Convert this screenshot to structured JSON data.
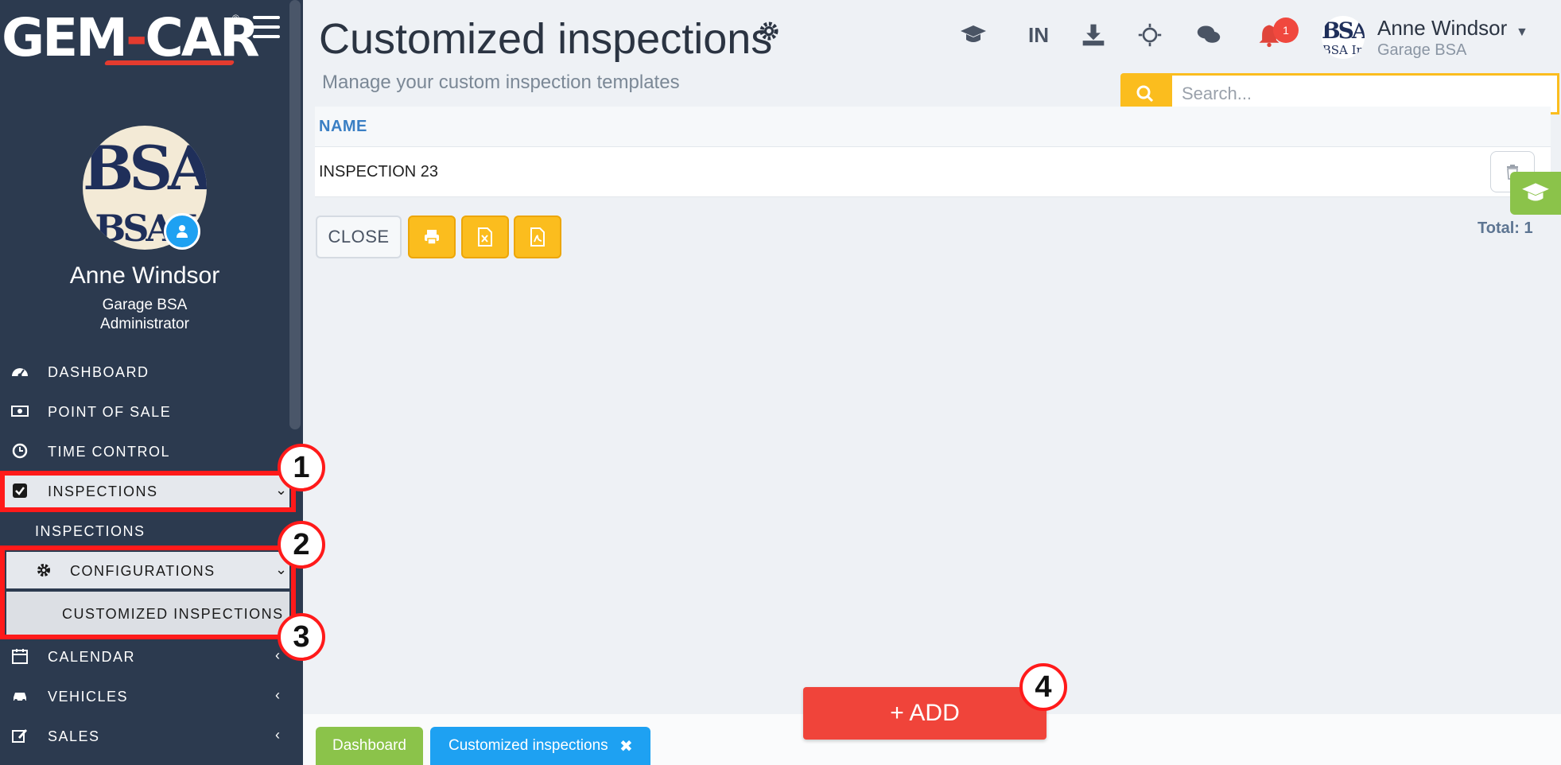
{
  "app": {
    "logo_text": "GEM-CAR",
    "logo_reg": "®"
  },
  "sidebar": {
    "profile": {
      "name": "Anne Windsor",
      "company": "Garage BSA",
      "role": "Administrator",
      "avatar_text": "BSA",
      "avatar_text_2": "BSA I"
    },
    "items": [
      {
        "label": "DASHBOARD",
        "icon": "tachometer-icon"
      },
      {
        "label": "POINT OF SALE",
        "icon": "money-icon"
      },
      {
        "label": "TIME CONTROL",
        "icon": "clock-icon"
      },
      {
        "label": "INSPECTIONS",
        "icon": "check-square-icon",
        "expanded": true
      },
      {
        "label": "INSPECTIONS",
        "icon": ""
      },
      {
        "label": "CONFIGURATIONS",
        "icon": "gear-icon",
        "expanded": true
      },
      {
        "label": "CUSTOMIZED INSPECTIONS",
        "icon": "",
        "active": true
      },
      {
        "label": "CALENDAR",
        "icon": "calendar-icon"
      },
      {
        "label": "VEHICLES",
        "icon": "car-icon"
      },
      {
        "label": "SALES",
        "icon": "edit-icon"
      }
    ]
  },
  "header": {
    "title": "Customized inspections",
    "subtitle": "Manage your custom inspection templates",
    "lang": "IN",
    "notifications_count": "1",
    "user_name": "Anne Windsor",
    "user_company": "Garage BSA",
    "user_avatar_text": "BSA",
    "user_avatar_text_2": "BSA In"
  },
  "search": {
    "placeholder": "Search..."
  },
  "table": {
    "columns": [
      "NAME"
    ],
    "rows": [
      {
        "name": "INSPECTION 23"
      }
    ],
    "total": "Total: 1"
  },
  "actions": {
    "close_label": "CLOSE",
    "add_label": "+ ADD"
  },
  "tabs": [
    {
      "label": "Dashboard"
    },
    {
      "label": "Customized inspections",
      "close": "✖"
    }
  ],
  "annotations": {
    "markers": [
      "1",
      "2",
      "3",
      "4"
    ]
  },
  "colors": {
    "sidebar_bg": "#2c3a4f",
    "accent_yellow": "#fbbd1e",
    "add_red": "#f0443a",
    "tab_green": "#8bc34a",
    "tab_blue": "#1ea1f2",
    "annotation_red": "#ff1a1a"
  }
}
